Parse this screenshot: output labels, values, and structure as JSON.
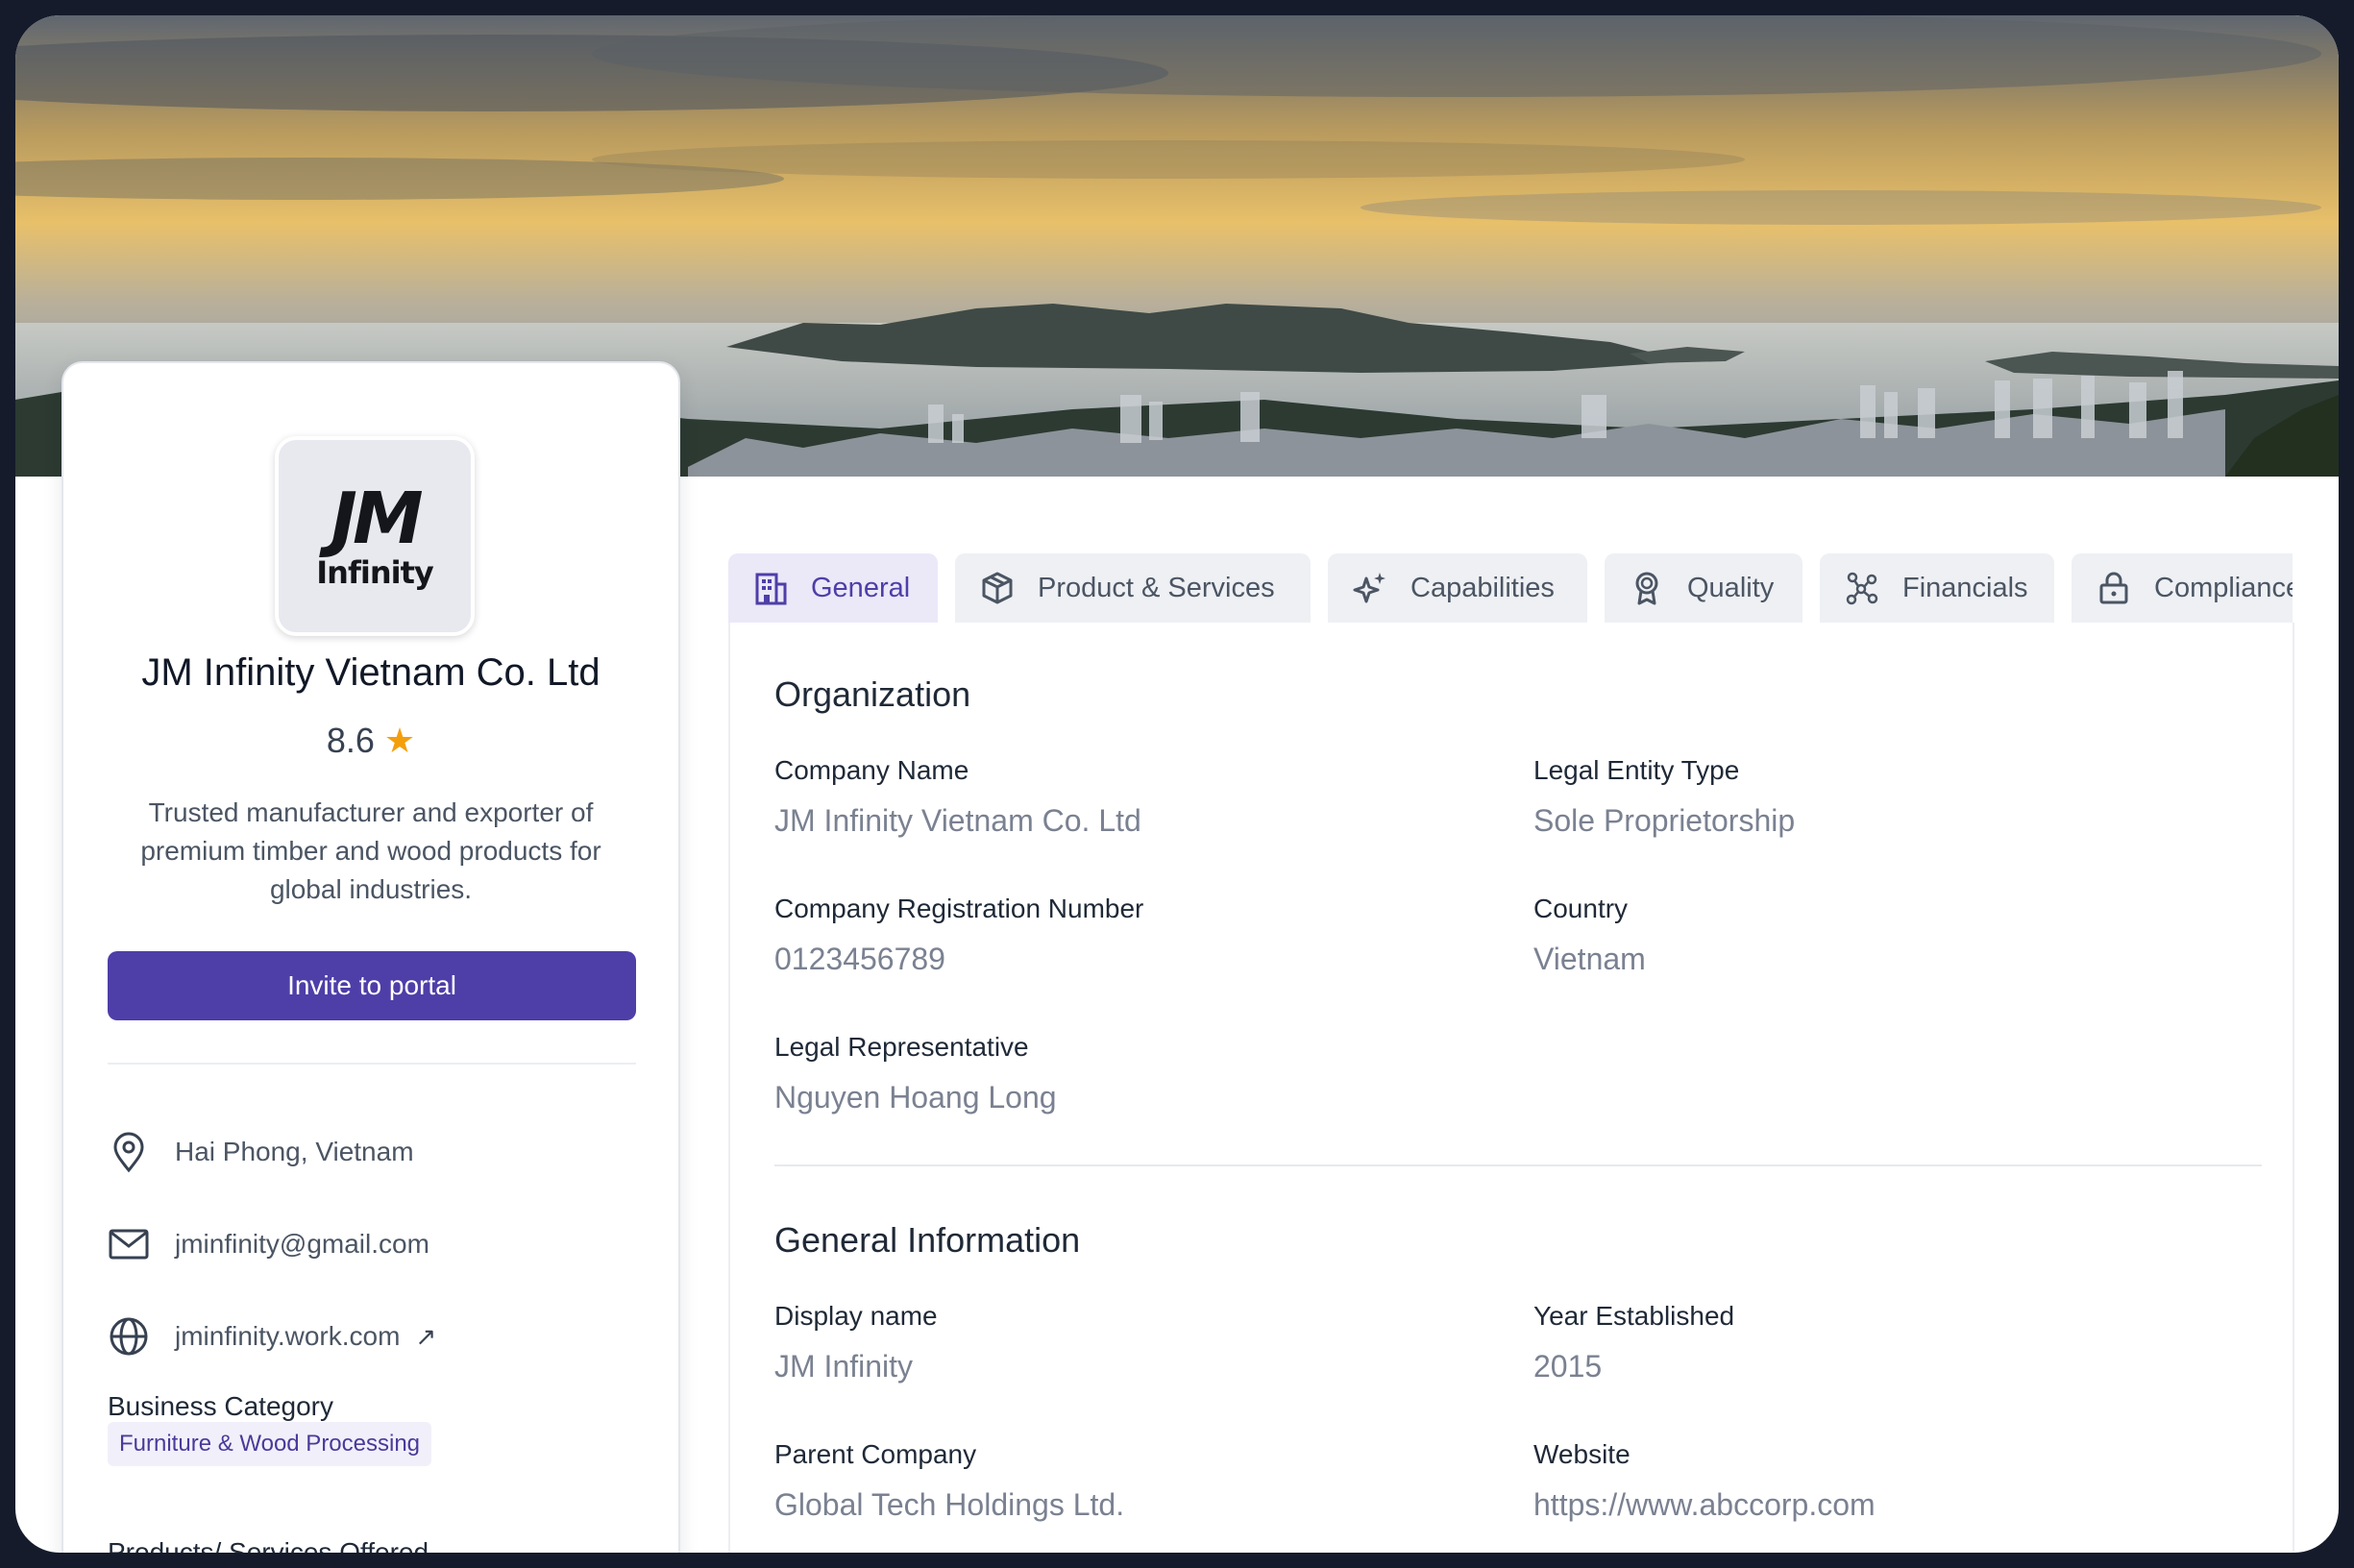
{
  "profile": {
    "logo_main": "JM",
    "logo_sub": "Infinity",
    "company_name": "JM Infinity Vietnam Co. Ltd",
    "rating": "8.6",
    "tagline": "Trusted manufacturer and exporter of premium timber and wood products for global industries.",
    "invite_label": "Invite to portal",
    "location": "Hai Phong, Vietnam",
    "email": "jminfinity@gmail.com",
    "website": "jminfinity.work.com",
    "business_category_label": "Business Category",
    "business_category": "Furniture & Wood Processing",
    "products_label": "Products/ Services Offered"
  },
  "tabs": [
    {
      "label": "General",
      "icon": "building-icon",
      "active": true
    },
    {
      "label": "Product & Services",
      "icon": "box-icon"
    },
    {
      "label": "Capabilities",
      "icon": "sparkles-icon"
    },
    {
      "label": "Quality",
      "icon": "award-icon"
    },
    {
      "label": "Financials",
      "icon": "network-icon"
    },
    {
      "label": "Compliance",
      "icon": "lock-icon"
    }
  ],
  "organization": {
    "title": "Organization",
    "company_name_label": "Company Name",
    "company_name": "JM Infinity Vietnam Co. Ltd",
    "legal_entity_label": "Legal Entity Type",
    "legal_entity": "Sole Proprietorship",
    "reg_number_label": "Company Registration Number",
    "reg_number": "0123456789",
    "country_label": "Country",
    "country": "Vietnam",
    "legal_rep_label": "Legal Representative",
    "legal_rep": "Nguyen Hoang Long"
  },
  "general_info": {
    "title": "General Information",
    "display_name_label": "Display name",
    "display_name": "JM Infinity",
    "year_label": "Year Established",
    "year": "2015",
    "parent_label": "Parent Company",
    "parent": "Global Tech Holdings Ltd.",
    "website_label": "Website",
    "website": "https://www.abccorp.com"
  },
  "colors": {
    "accent": "#4e3ea8",
    "star": "#f59e0b",
    "chip_bg": "#f1f0fa"
  }
}
